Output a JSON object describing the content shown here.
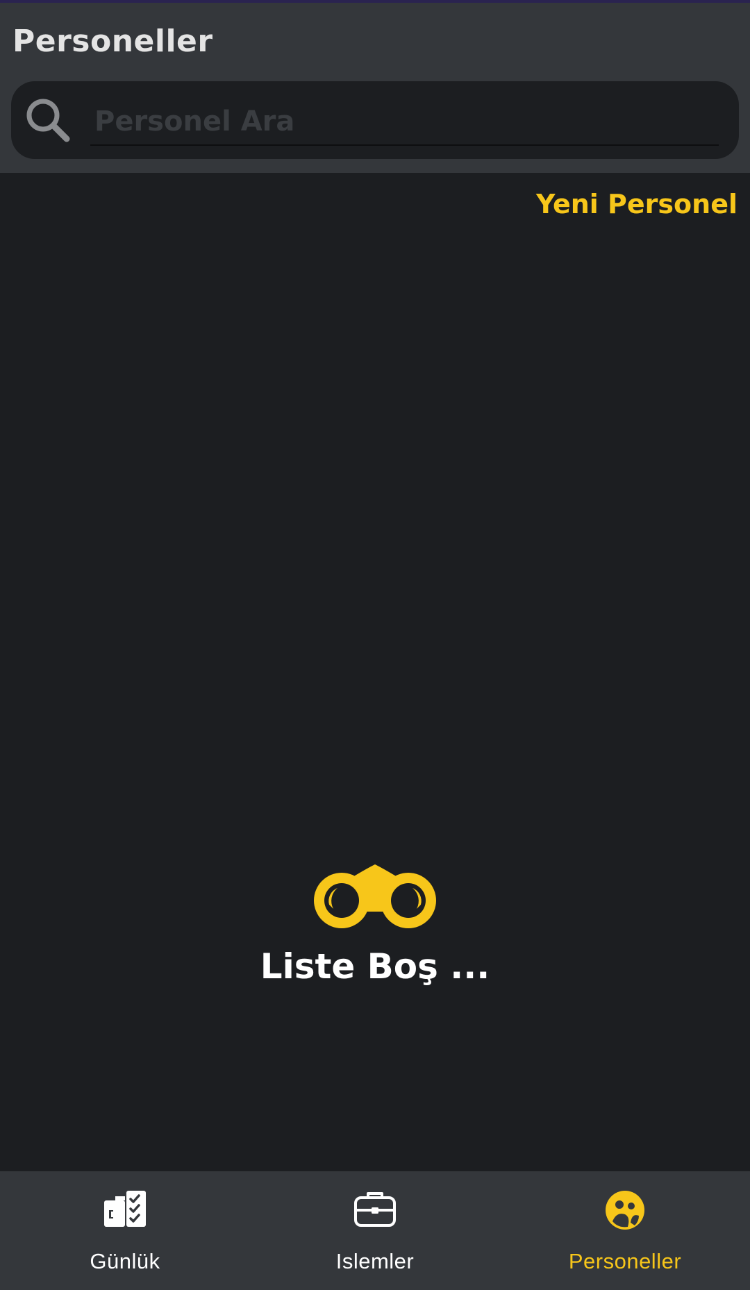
{
  "header": {
    "title": "Personeller",
    "search": {
      "placeholder": "Personel Ara",
      "value": ""
    }
  },
  "actions": {
    "new_label": "Yeni Personel"
  },
  "empty_state": {
    "icon": "binoculars-icon",
    "text": "Liste Boş ..."
  },
  "bottom_nav": {
    "items": [
      {
        "label": "Günlük",
        "icon": "daily-checklist-icon",
        "active": false
      },
      {
        "label": "Islemler",
        "icon": "briefcase-icon",
        "active": false
      },
      {
        "label": "Personeller",
        "icon": "personnel-icon",
        "active": true
      }
    ]
  },
  "colors": {
    "accent": "#f7c61a",
    "background": "#1c1e21",
    "surface": "#34373b",
    "text": "#ffffff"
  }
}
